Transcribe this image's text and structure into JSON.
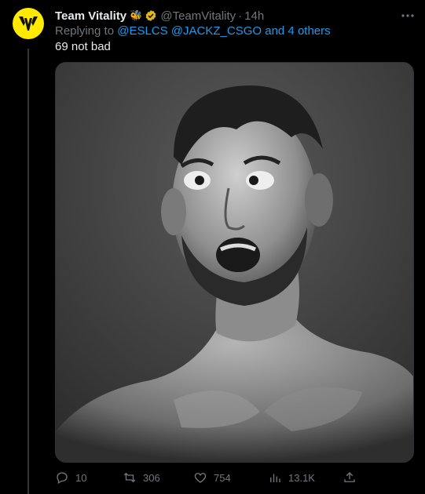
{
  "tweet": {
    "author_name": "Team Vitality",
    "author_emoji": "🐝",
    "handle": "@TeamVitality",
    "separator": "·",
    "time": "14h",
    "replying_prefix": "Replying to ",
    "mention_1": "@ESLCS",
    "mention_2": "@JACKZ_CSGO",
    "and_others": "and 4 others",
    "text": "69 not bad",
    "media_description_icon": "photo"
  },
  "stats": {
    "replies": "10",
    "retweets": "306",
    "likes": "754",
    "views": "13.1K"
  },
  "colors": {
    "background": "#000000",
    "text": "#e7e9ea",
    "muted": "#71767b",
    "link": "#1d9bf0",
    "avatar_bg": "#ffea00",
    "verified": "#e2b719"
  },
  "icons": {
    "more": "more-dots-icon",
    "reply": "reply-icon",
    "retweet": "retweet-icon",
    "like": "heart-icon",
    "views": "views-icon",
    "share": "share-icon"
  }
}
